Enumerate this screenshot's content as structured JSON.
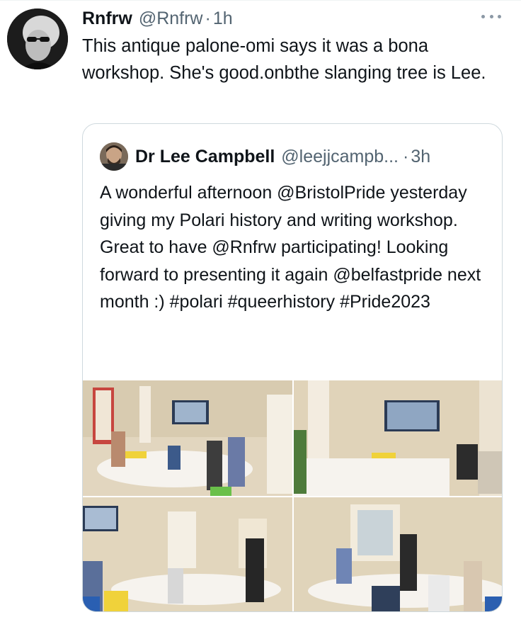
{
  "author": {
    "display_name": "Rnfrw",
    "handle": "@Rnfrw",
    "separator": "·",
    "time": "1h"
  },
  "tweet": {
    "text": "This antique palone-omi says it was a bona workshop. She's good.onbthe slanging tree is Lee."
  },
  "quote": {
    "display_name": "Dr Lee Campbell",
    "handle": "@leejjcampb...",
    "separator": "·",
    "time": "3h",
    "text": "A wonderful afternoon @BristolPride yesterday giving my Polari history and writing workshop. Great to have @Rnfrw participating! Looking forward to presenting it again @belfastpride next month :) #polari #queerhistory #Pride2023"
  },
  "icons": {
    "more": "more-horizontal-icon"
  },
  "colors": {
    "text_primary": "#0f1419",
    "text_secondary": "#536471",
    "border": "#cfd9de"
  }
}
